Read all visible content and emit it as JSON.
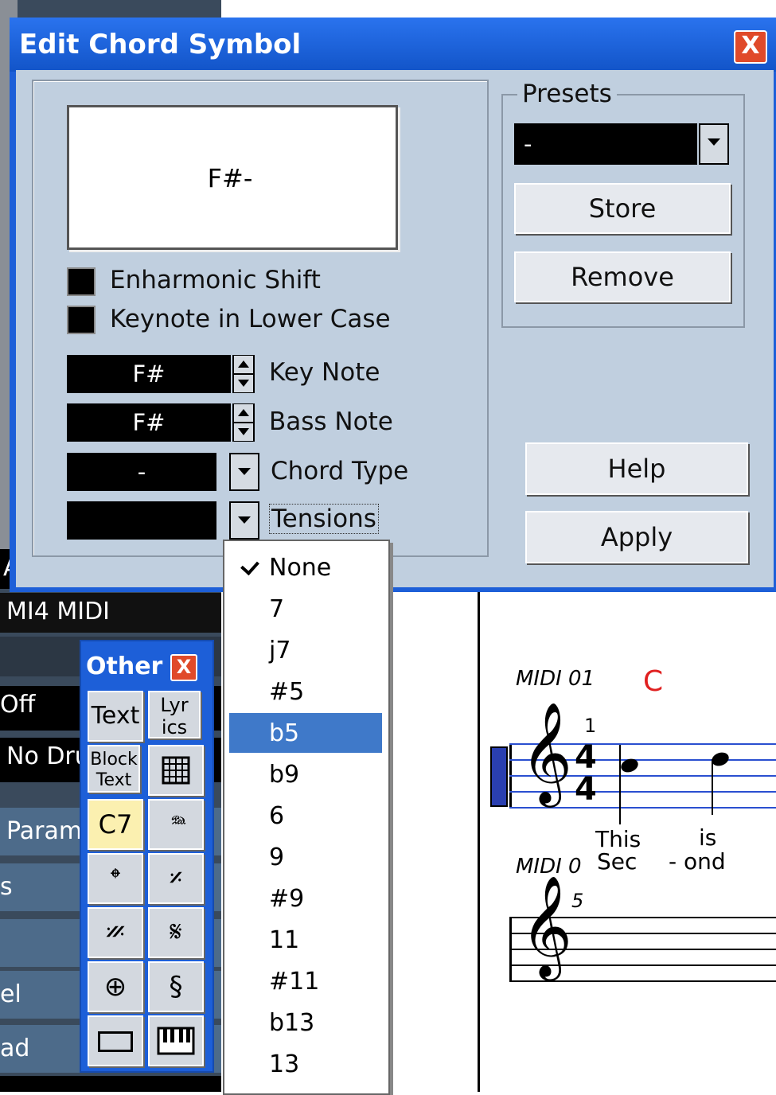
{
  "dialog": {
    "title": "Edit Chord Symbol",
    "close_glyph": "X",
    "preview_text": "F#-",
    "enharmonic_label": "Enharmonic Shift",
    "lowercase_label": "Keynote in Lower Case",
    "key_note_value": "F#",
    "key_note_label": "Key Note",
    "bass_note_value": "F#",
    "bass_note_label": "Bass Note",
    "chord_type_value": "-",
    "chord_type_label": "Chord Type",
    "tensions_value": "",
    "tensions_label": "Tensions",
    "presets_label": "Presets",
    "presets_value": "-",
    "store_label": "Store",
    "remove_label": "Remove",
    "help_label": "Help",
    "apply_label": "Apply"
  },
  "tensions_menu": {
    "items": [
      {
        "label": "None",
        "checked": true
      },
      {
        "label": "7"
      },
      {
        "label": "j7"
      },
      {
        "label": "#5"
      },
      {
        "label": "b5",
        "highlighted": true
      },
      {
        "label": "b9"
      },
      {
        "label": "6"
      },
      {
        "label": "9"
      },
      {
        "label": "#9"
      },
      {
        "label": "11"
      },
      {
        "label": "#11"
      },
      {
        "label": "b13"
      },
      {
        "label": "13"
      }
    ]
  },
  "other_palette": {
    "title": "Other",
    "close_glyph": "X",
    "text_label": "Text",
    "lyrics_label": "Lyr ics",
    "block_text_label": "Block Text",
    "chord_label": "C7"
  },
  "background": {
    "row_a": "A",
    "midi_label": "MI4 MIDI",
    "off_label": "Off",
    "no_drum_label": "No Dru",
    "param_label": "Param",
    "s_label": "s",
    "el_label": "el",
    "ad_label": "ad"
  },
  "score": {
    "track1_name": "MIDI 01",
    "chord_symbol": "C",
    "bar1_number": "1",
    "time_sig_top": "4",
    "time_sig_bottom": "4",
    "lyric1": "This",
    "lyric2": "is",
    "lyric3": "Sec",
    "lyric4": "- ond",
    "track2_name": "MIDI 0",
    "bar2_number": "5"
  },
  "colors": {
    "title_bar": "#1d5fd8",
    "dialog_body": "#c0cfdf",
    "menu_highlight": "#3f79c9",
    "staff_line": "#2a4fd0",
    "chord_symbol": "#e02020"
  }
}
